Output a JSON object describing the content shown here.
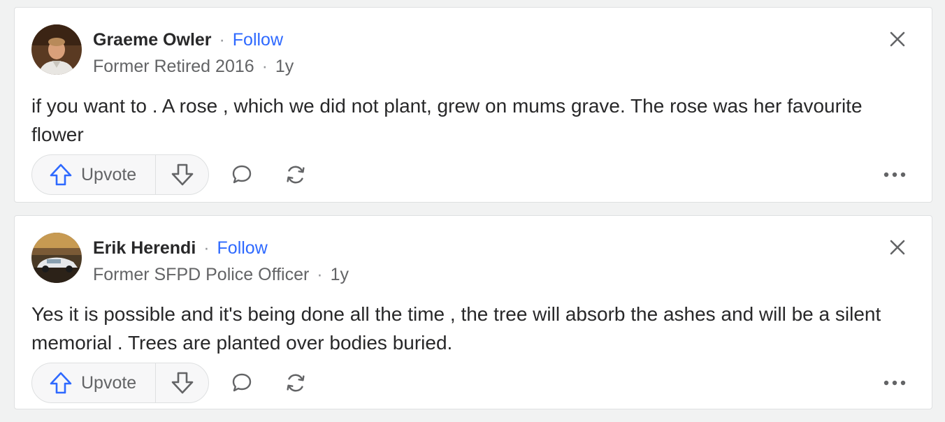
{
  "colors": {
    "page_background": "#f1f2f2",
    "card_background": "#ffffff",
    "follow_link": "#2e69ff",
    "upvote_icon": "#2e69ff",
    "body_text": "#282829",
    "meta_text": "#636466"
  },
  "answers": [
    {
      "author_name": "Graeme Owler",
      "separator": "·",
      "follow_label": "Follow",
      "credential": "Former Retired 2016",
      "meta_separator": "·",
      "time": "1y",
      "body": "if you want to . A rose , which we did not plant, grew on mums grave. The rose was her favourite flower",
      "upvote_label": "Upvote",
      "avatar_icon": "person-photo-avatar",
      "close_icon": "close-icon",
      "comment_icon": "comment-icon",
      "share_icon": "share-icon",
      "more_icon": "more-icon"
    },
    {
      "author_name": "Erik Herendi",
      "separator": "·",
      "follow_label": "Follow",
      "credential": "Former SFPD Police Officer",
      "meta_separator": "·",
      "time": "1y",
      "body": "Yes it is possible and it's being done all the time , the tree will absorb the ashes and will be a silent memorial . Trees are planted over bodies buried.",
      "upvote_label": "Upvote",
      "avatar_icon": "car-photo-avatar",
      "close_icon": "close-icon",
      "comment_icon": "comment-icon",
      "share_icon": "share-icon",
      "more_icon": "more-icon"
    }
  ]
}
